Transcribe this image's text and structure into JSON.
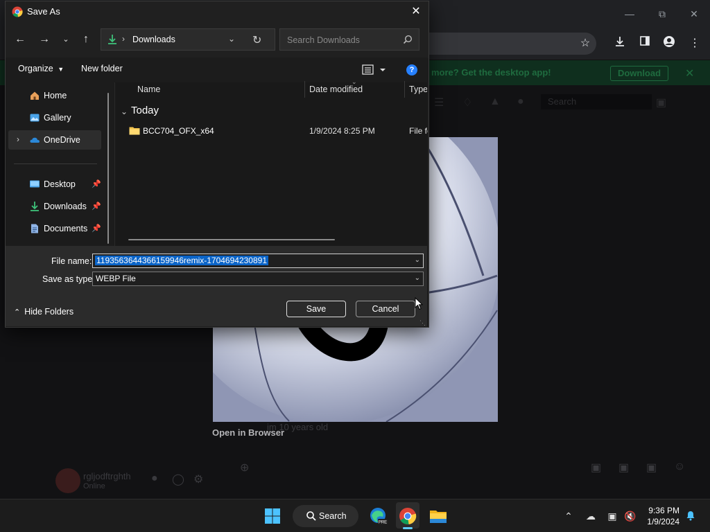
{
  "browser": {
    "banner_text": "more? Get the desktop app!",
    "banner_button": "Download",
    "search_placeholder": "Search",
    "open_in_browser": "Open in Browser",
    "faded_message": "im 10 years old",
    "faded_username": "rgljodftrghth",
    "faded_status": "Online"
  },
  "dialog": {
    "title": "Save As",
    "address": {
      "location": "Downloads",
      "separator": "›"
    },
    "search_placeholder": "Search Downloads",
    "commands": {
      "organize": "Organize",
      "new_folder": "New folder",
      "help": "?"
    },
    "nav_pane": {
      "items": [
        {
          "label": "Home",
          "icon": "home-icon"
        },
        {
          "label": "Gallery",
          "icon": "gallery-icon"
        },
        {
          "label": "OneDrive",
          "icon": "cloud-icon",
          "selected": true
        },
        {
          "label": "Desktop",
          "icon": "desktop-icon",
          "pinned": true
        },
        {
          "label": "Downloads",
          "icon": "download-icon",
          "pinned": true
        },
        {
          "label": "Documents",
          "icon": "documents-icon",
          "pinned": true
        }
      ]
    },
    "columns": {
      "name": "Name",
      "date_modified": "Date modified",
      "type": "Type"
    },
    "group": "Today",
    "files": [
      {
        "name": "BCC704_OFX_x64",
        "date_modified": "1/9/2024 8:25 PM",
        "type": "File fo"
      }
    ],
    "file_name": {
      "label": "File name:",
      "value": "1193563644366159946remix-1704694230891"
    },
    "save_as_type": {
      "label": "Save as type:",
      "value": "WEBP File"
    },
    "hide_folders": "Hide Folders",
    "save_button": "Save",
    "cancel_button": "Cancel"
  },
  "taskbar": {
    "search_label": "Search",
    "time": "9:36 PM",
    "date": "1/9/2024"
  }
}
